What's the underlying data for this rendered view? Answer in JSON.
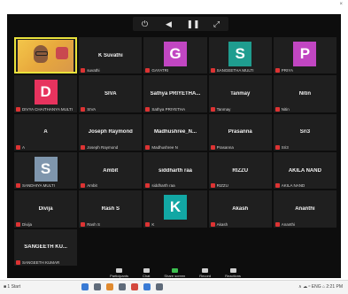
{
  "window": {
    "close_label": "×"
  },
  "top_controls": [
    {
      "icon": "stop-icon",
      "glyph": "⏻"
    },
    {
      "icon": "volume-icon",
      "glyph": "◀"
    },
    {
      "icon": "pause-icon",
      "glyph": "❚❚"
    },
    {
      "icon": "expand-icon",
      "glyph": "⤢"
    }
  ],
  "tiles": [
    {
      "type": "video",
      "label": "",
      "active": true
    },
    {
      "type": "name",
      "name": "K Suvathi",
      "label": "suvathi"
    },
    {
      "type": "avatar",
      "letter": "G",
      "color": "#c146c2",
      "label": "GAYATRI"
    },
    {
      "type": "avatar",
      "letter": "S",
      "color": "#1f9d8f",
      "label": "SANGEETHA MULTI"
    },
    {
      "type": "avatar",
      "letter": "P",
      "color": "#c146c2",
      "label": "PRIYA"
    },
    {
      "type": "avatar",
      "letter": "D",
      "color": "#e7335e",
      "label": "DIVYA CHAITHANYA MULTI"
    },
    {
      "type": "name",
      "name": "SIVA",
      "label": "SIVA"
    },
    {
      "type": "name",
      "name": "Sathya PRIYETHA...",
      "label": "Sathya PRIYETHA"
    },
    {
      "type": "name",
      "name": "Tanmay",
      "label": "Tanmay"
    },
    {
      "type": "name",
      "name": "Nitin",
      "label": "Nitin"
    },
    {
      "type": "name",
      "name": "A",
      "label": "A"
    },
    {
      "type": "name",
      "name": "Joseph Raymond",
      "label": "Joseph Raymond"
    },
    {
      "type": "name",
      "name": "Madhushree_N...",
      "label": "Madhushree N"
    },
    {
      "type": "name",
      "name": "Prasanna",
      "label": "Prasanna"
    },
    {
      "type": "name",
      "name": "Sri3",
      "label": "Sri3"
    },
    {
      "type": "avatar",
      "letter": "S",
      "color": "#7f96ad",
      "label": "SANDHIYA MULTI"
    },
    {
      "type": "name",
      "name": "Ambit",
      "label": "Ambit"
    },
    {
      "type": "name",
      "name": "siddharth raa",
      "label": "siddharth raa"
    },
    {
      "type": "name",
      "name": "RIZZU",
      "label": "RIZZU"
    },
    {
      "type": "name",
      "name": "AKILA NAND",
      "label": "AKILA NAND"
    },
    {
      "type": "name",
      "name": "Divija",
      "label": "Divija"
    },
    {
      "type": "name",
      "name": "Rash S",
      "label": "Rash S"
    },
    {
      "type": "avatar",
      "letter": "K",
      "color": "#12a7a4",
      "label": "K"
    },
    {
      "type": "name",
      "name": "Akash",
      "label": "Akash"
    },
    {
      "type": "name",
      "name": "Ananthi",
      "label": "Ananthi"
    },
    {
      "type": "name",
      "name": "SANGEETH KU...",
      "label": "SANGEETH KUMAR"
    }
  ],
  "bottom_buttons": [
    {
      "label": "Participants",
      "icon": "participants-icon",
      "green": false
    },
    {
      "label": "Chat",
      "icon": "chat-icon",
      "green": false
    },
    {
      "label": "Share screen",
      "icon": "share-screen-icon",
      "green": true
    },
    {
      "label": "Record",
      "icon": "record-icon",
      "green": false
    },
    {
      "label": "Reactions",
      "icon": "reactions-icon",
      "green": false
    }
  ],
  "taskbar": {
    "left_text": "■ 1 Start",
    "right_text": "∧  ☁  ᵒ  ENG  ⌂  2:21 PM"
  }
}
